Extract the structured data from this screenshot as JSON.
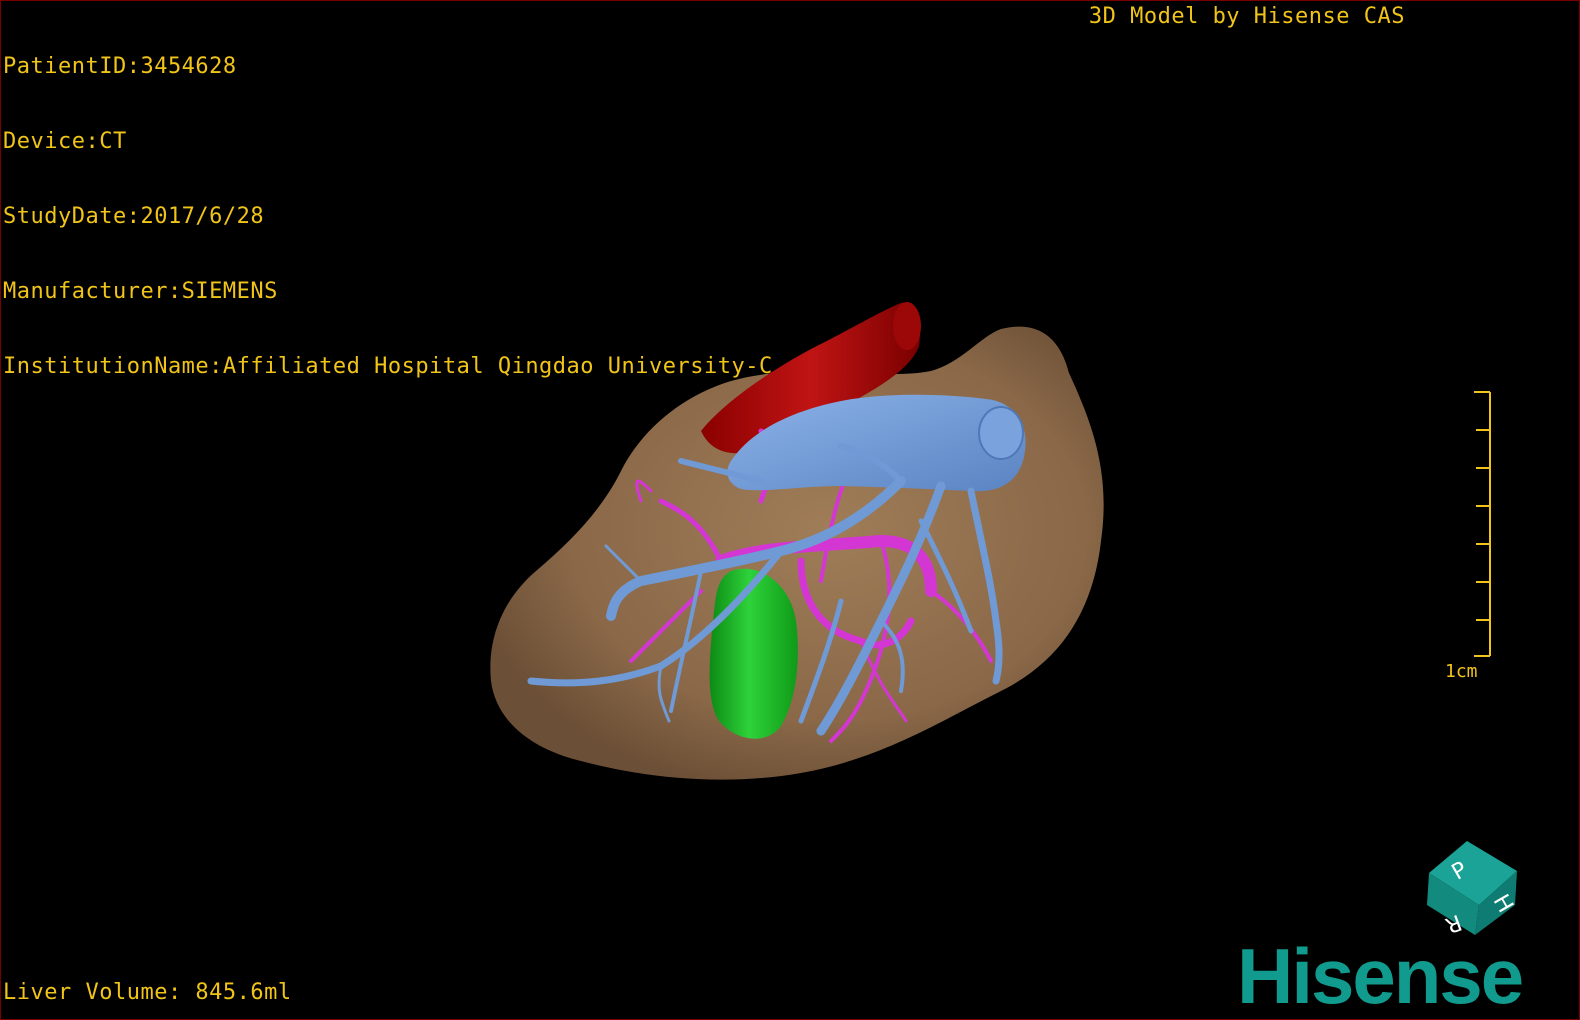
{
  "info": {
    "patient_id": "PatientID:3454628",
    "device": "Device:CT",
    "study_date": "StudyDate:2017/6/28",
    "manufacturer": "Manufacturer:SIEMENS",
    "institution": "InstitutionName:Affiliated Hospital Qingdao University-C"
  },
  "credit": "3D Model by Hisense CAS",
  "volume": "Liver Volume: 845.6ml",
  "scale": {
    "label": "1cm"
  },
  "cube": {
    "letters": [
      "P",
      "H",
      "R"
    ]
  },
  "brand": "Hisense",
  "colors": {
    "text": "#f0c419",
    "liver": "#8c6a4a",
    "hepatic_vein": "#6f9ad6",
    "portal_vein": "#d436d4",
    "vena_cava": "#b00c0c",
    "tumor": "#1fb82a",
    "brand": "#109b8e"
  }
}
